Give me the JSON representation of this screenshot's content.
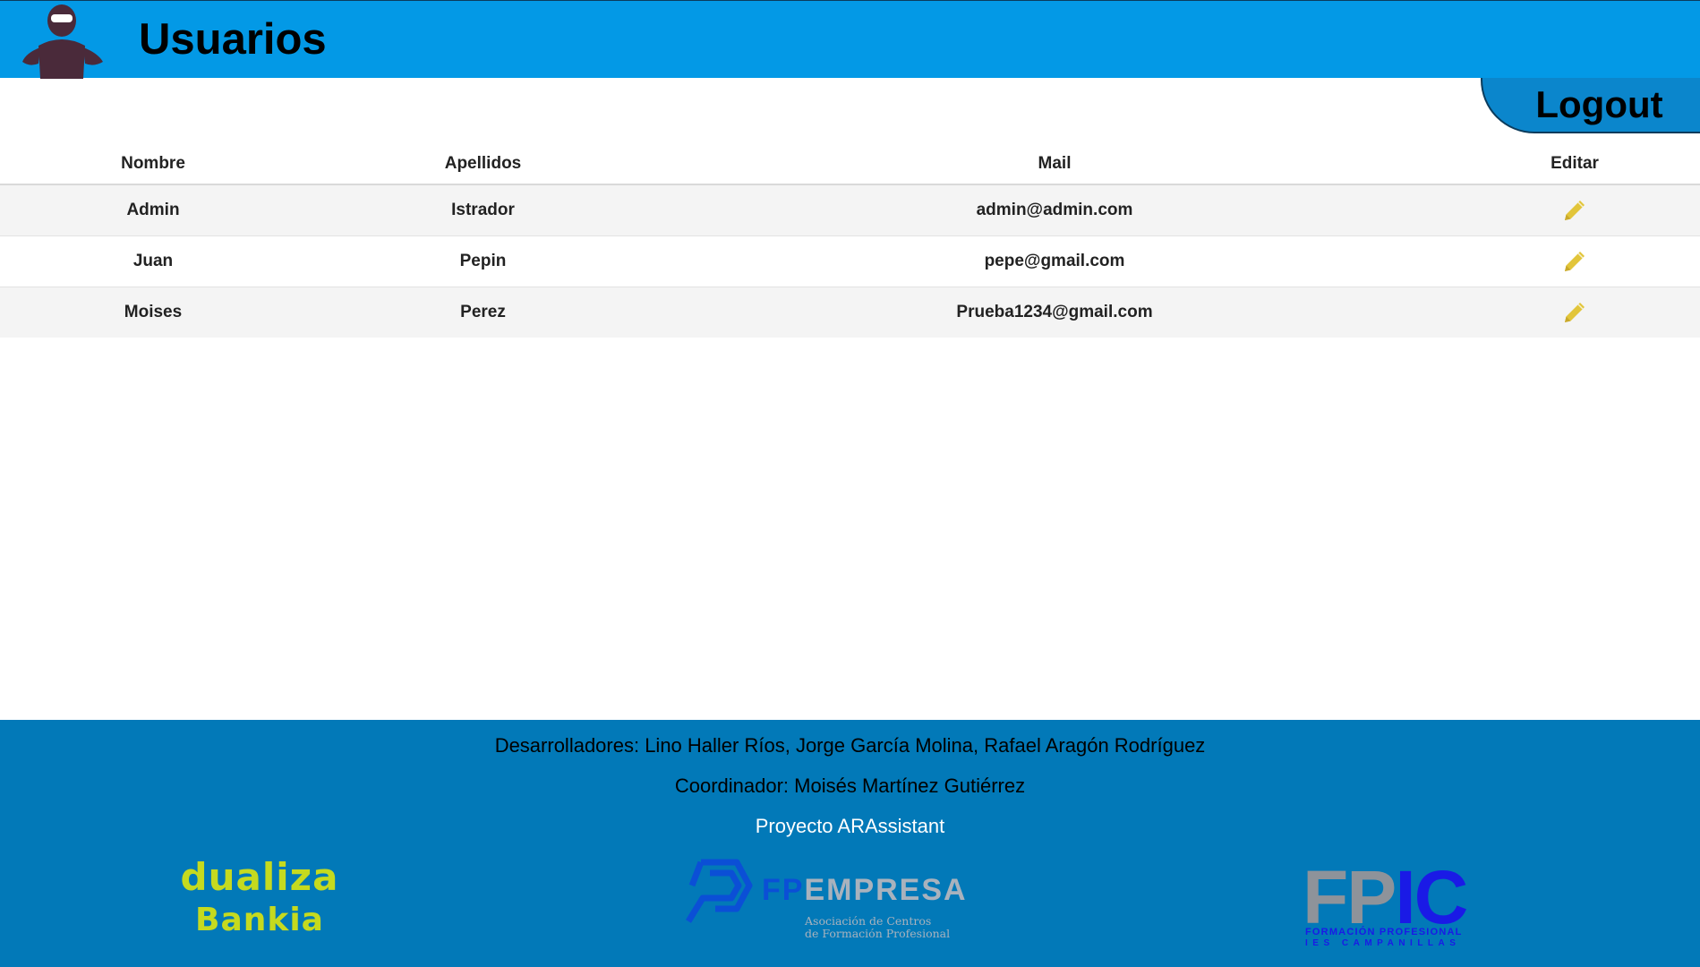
{
  "header": {
    "title": "Usuarios"
  },
  "logout_label": "Logout",
  "table": {
    "columns": [
      "Nombre",
      "Apellidos",
      "Mail",
      "Editar"
    ],
    "rows": [
      {
        "nombre": "Admin",
        "apellidos": "Istrador",
        "mail": "admin@admin.com"
      },
      {
        "nombre": "Juan",
        "apellidos": "Pepin",
        "mail": "pepe@gmail.com"
      },
      {
        "nombre": "Moises",
        "apellidos": "Perez",
        "mail": "Prueba1234@gmail.com"
      }
    ],
    "edit_icon": "pencil-icon"
  },
  "footer": {
    "developers": "Desarrolladores: Lino Haller Ríos, Jorge García Molina, Rafael Aragón Rodríguez",
    "coordinator": "Coordinador: Moisés Martínez Gutiérrez",
    "project": "Proyecto ARAssistant",
    "logos": {
      "dualiza": {
        "line1": "dualiza",
        "line2": "Bankia"
      },
      "fpempresa": {
        "fp": "FP",
        "name": "EMPRESA",
        "sub1": "Asociación de Centros",
        "sub2": "de Formación Profesional"
      },
      "fpic": {
        "fp": "FP",
        "ic": "IC",
        "sub1": "FORMACIÓN PROFESIONAL",
        "sub2": "IES CAMPANILLAS"
      }
    }
  },
  "colors": {
    "header_bg": "#0399e6",
    "footer_bg": "#0279b8",
    "logout_bg": "#0b86cc",
    "edit_icon": "#e2c53a",
    "dualiza_green": "#c5da1f"
  }
}
